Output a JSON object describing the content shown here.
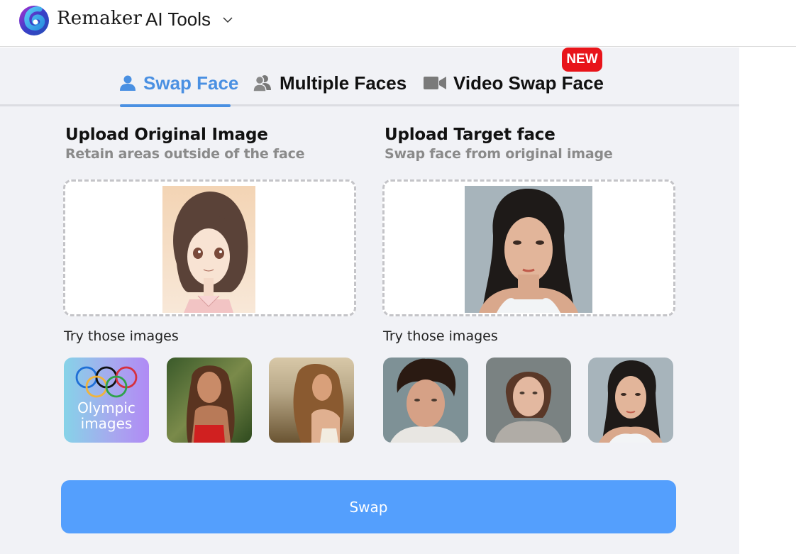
{
  "header": {
    "brand": "Remaker",
    "menu_label": "AI Tools"
  },
  "tabs": [
    {
      "label": "Swap Face",
      "icon": "user-icon",
      "active": true
    },
    {
      "label": "Multiple Faces",
      "icon": "users-icon",
      "active": false
    },
    {
      "label": "Video Swap Face",
      "icon": "video-camera-icon",
      "active": false,
      "badge": "NEW"
    }
  ],
  "original": {
    "title": "Upload Original Image",
    "subtitle": "Retain areas outside of the face",
    "preview_alt": "anime girl portrait",
    "try_label": "Try those images",
    "samples": [
      {
        "label": "Olympic images",
        "kind": "olympic-category"
      },
      {
        "label": "woman in red top, forest",
        "kind": "photo"
      },
      {
        "label": "woman with long hair, beach",
        "kind": "photo"
      }
    ]
  },
  "target": {
    "title": "Upload Target face",
    "subtitle": "Swap face from original image",
    "preview_alt": "woman with long black hair portrait",
    "try_label": "Try those images",
    "samples": [
      {
        "label": "man with curly hair",
        "kind": "photo"
      },
      {
        "label": "woman with updo, grey sweater",
        "kind": "photo"
      },
      {
        "label": "woman with long black hair",
        "kind": "photo"
      }
    ]
  },
  "olympic_label_line1": "Olympic",
  "olympic_label_line2": "images",
  "action": {
    "swap_label": "Swap"
  },
  "colors": {
    "accent": "#4a90e2",
    "button": "#549ffd",
    "badge": "#e8141a",
    "background": "#f1f2f6"
  }
}
